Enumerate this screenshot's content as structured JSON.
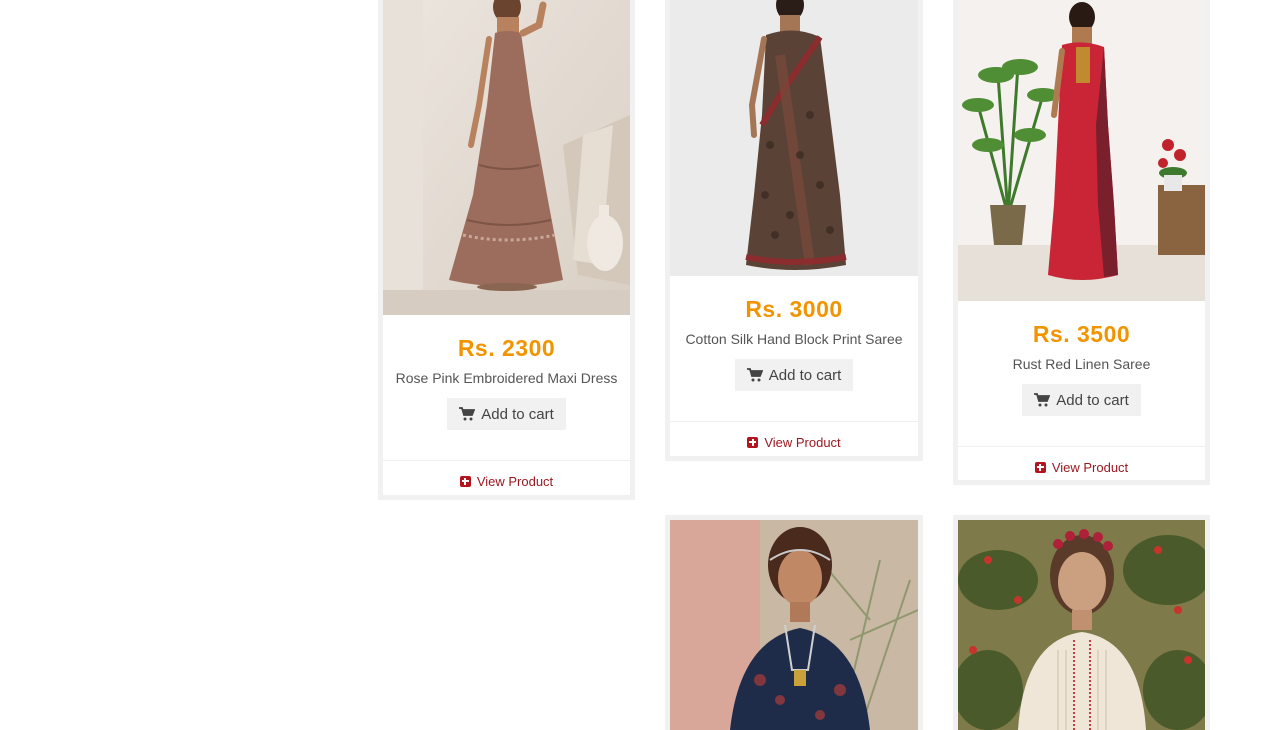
{
  "cart_label": "Add to cart",
  "view_label": "View Product",
  "accent_color": "#f29400",
  "link_color": "#9b1a22",
  "products": [
    {
      "price": "Rs. 2300",
      "name": "Rose Pink Embroidered Maxi Dress"
    },
    {
      "price": "Rs. 3000",
      "name": "Cotton Silk Hand Block Print Saree"
    },
    {
      "price": "Rs. 3500",
      "name": "Rust Red Linen Saree"
    },
    {
      "price": "",
      "name": ""
    },
    {
      "price": "",
      "name": ""
    }
  ]
}
